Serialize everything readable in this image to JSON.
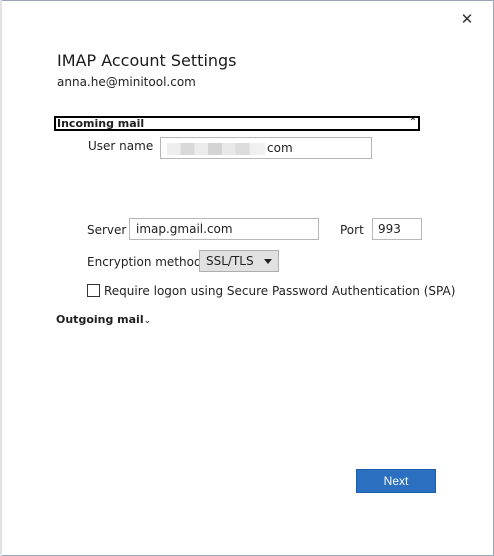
{
  "window": {
    "close_glyph": "✕"
  },
  "header": {
    "title": "IMAP Account Settings",
    "email": "anna.he@minitool.com"
  },
  "incoming": {
    "section_label": "Incoming mail",
    "collapse_glyph": "⌃",
    "username_label": "User name",
    "username_value_visible": "com",
    "server_label": "Server",
    "server_value": "imap.gmail.com",
    "port_label": "Port",
    "port_value": "993",
    "encryption_label": "Encryption method",
    "encryption_value": "SSL/TLS",
    "spa_label": "Require logon using Secure Password Authentication (SPA)",
    "spa_checked": false
  },
  "outgoing": {
    "section_label": "Outgoing mail",
    "expand_glyph": "⌄"
  },
  "footer": {
    "next_label": "Next"
  },
  "colors": {
    "accent": "#2a6fc0",
    "border": "#b7b7b7",
    "select_bg": "#e1e1e1"
  }
}
